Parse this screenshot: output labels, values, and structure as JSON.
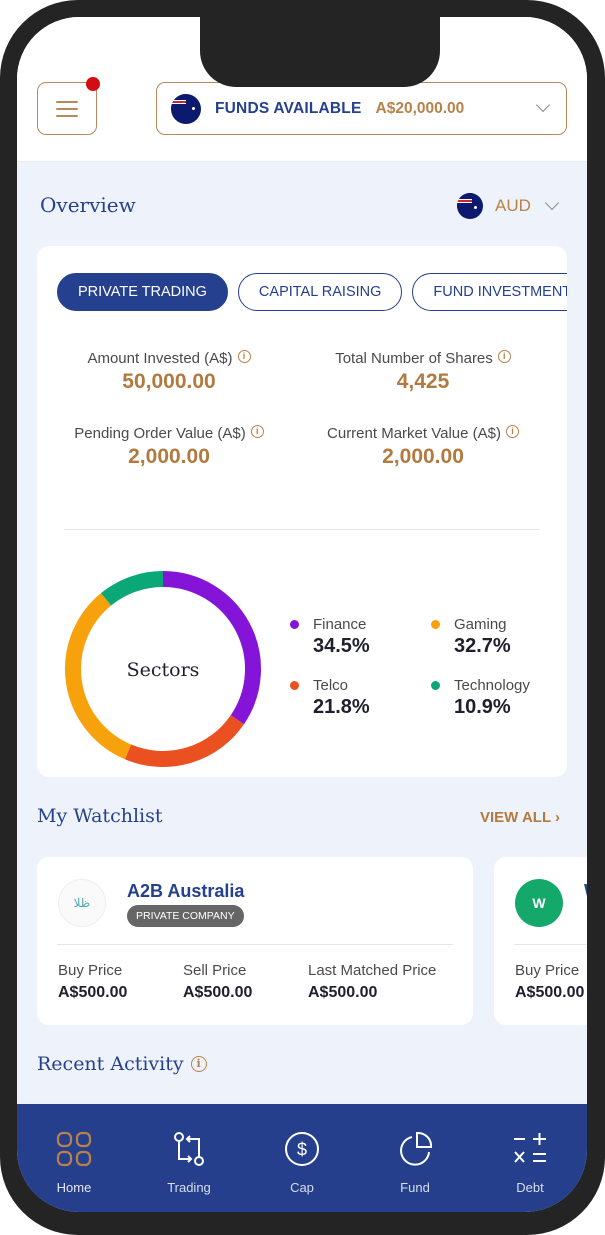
{
  "header": {
    "menu_icon": "hamburger-menu-icon",
    "notification_dot": true,
    "funds_label": "FUNDS AVAILABLE",
    "funds_amount": "A$20,000.00",
    "currency_flag": "australia-flag-icon"
  },
  "overview": {
    "title": "Overview",
    "currency": "AUD",
    "tabs": [
      {
        "label": "PRIVATE TRADING",
        "active": true
      },
      {
        "label": "CAPITAL RAISING",
        "active": false
      },
      {
        "label": "FUND INVESTMENT",
        "active": false
      }
    ],
    "stats": [
      {
        "label": "Amount Invested (A$)",
        "value": "50,000.00"
      },
      {
        "label": "Total Number of Shares",
        "value": "4,425"
      },
      {
        "label": "Pending Order Value (A$)",
        "value": "2,000.00"
      },
      {
        "label": "Current Market Value (A$)",
        "value": "2,000.00"
      }
    ]
  },
  "chart_data": {
    "type": "pie",
    "title": "Sectors",
    "categories": [
      "Finance",
      "Gaming",
      "Telco",
      "Technology"
    ],
    "values": [
      34.5,
      32.7,
      21.8,
      10.9
    ],
    "labels": [
      "34.5%",
      "32.7%",
      "21.8%",
      "10.9%"
    ],
    "colors": [
      "#8514d9",
      "#f7a20c",
      "#ea5020",
      "#0aa877"
    ],
    "ring_order": [
      "Finance",
      "Telco",
      "Gaming",
      "Technology"
    ],
    "legend_placement": "right"
  },
  "watchlist": {
    "title": "My Watchlist",
    "view_all": "VIEW ALL",
    "items": [
      {
        "name": "A2B Australia",
        "badge": "PRIVATE COMPANY",
        "buy_label": "Buy Price",
        "buy": "A$500.00",
        "sell_label": "Sell Price",
        "sell": "A$500.00",
        "last_label": "Last Matched Price",
        "last": "A$500.00"
      },
      {
        "name": "W",
        "logo_text": "W",
        "buy_label": "Buy Price",
        "buy": "A$500.00"
      }
    ]
  },
  "recent_activity": {
    "title": "Recent Activity"
  },
  "nav": [
    {
      "label": "Home",
      "icon": "home-grid-icon",
      "active": true
    },
    {
      "label": "Trading",
      "icon": "trading-swap-icon",
      "active": false
    },
    {
      "label": "Cap",
      "icon": "dollar-circle-icon",
      "active": false
    },
    {
      "label": "Fund",
      "icon": "pie-chart-icon",
      "active": false
    },
    {
      "label": "Debt",
      "icon": "calculator-icon",
      "active": false
    }
  ]
}
